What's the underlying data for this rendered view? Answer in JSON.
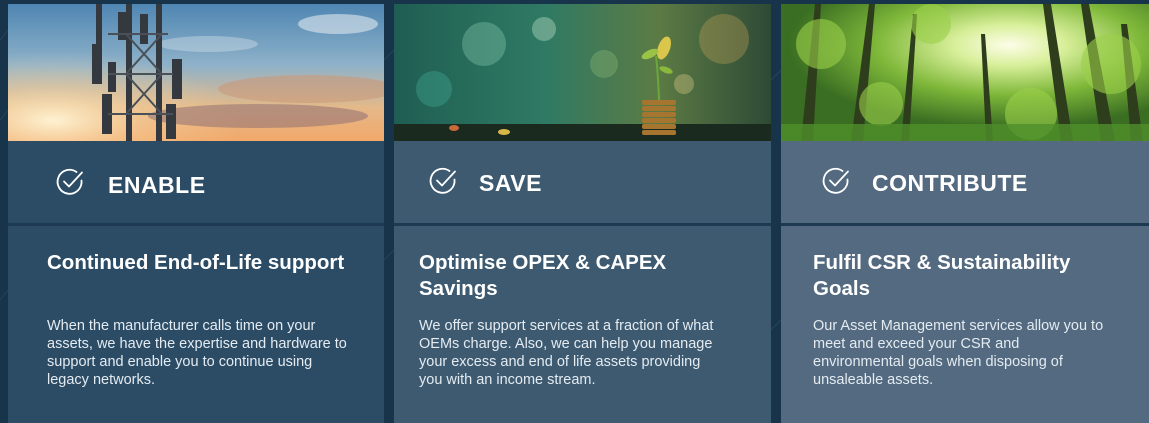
{
  "colors": {
    "page_background": "#18344a",
    "card_enable": "#2c4c66",
    "card_save": "#3d5a70",
    "card_contribute": "#536a80",
    "text": "#ffffff"
  },
  "cards": [
    {
      "image": "cell-tower-sunset-photo",
      "icon": "check-circle-icon",
      "heading": "ENABLE",
      "title": "Continued End-of-Life support",
      "text": "When the manufacturer calls time on your assets, we have the expertise and hardware to support and enable you to continue using legacy networks."
    },
    {
      "image": "sprout-on-coins-photo",
      "icon": "check-circle-icon",
      "heading": "SAVE",
      "title": "Optimise OPEX & CAPEX Savings",
      "text": "We offer support services at a fraction of what OEMs charge. Also, we can help you manage your excess and end of life assets providing you with an income stream."
    },
    {
      "image": "sunlit-forest-photo",
      "icon": "check-circle-icon",
      "heading": "CONTRIBUTE",
      "title": "Fulfil CSR & Sustainability Goals",
      "text": "Our Asset Management services allow you to meet and exceed your CSR and environmental goals when disposing of unsaleable assets."
    }
  ]
}
